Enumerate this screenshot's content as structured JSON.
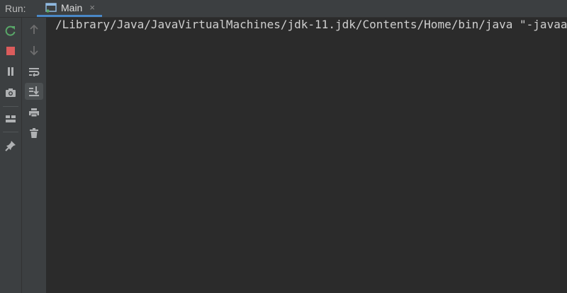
{
  "header": {
    "run_label": "Run:",
    "tab": {
      "label": "Main",
      "close_glyph": "×"
    }
  },
  "toolbar_left": [
    {
      "name": "rerun-icon",
      "color": "#59a869"
    },
    {
      "name": "stop-icon",
      "color": "#db5c5c"
    },
    {
      "name": "pause-icon",
      "color": "#afb1b3"
    },
    {
      "name": "camera-icon",
      "color": "#afb1b3"
    },
    {
      "name": "layout-icon",
      "color": "#afb1b3"
    },
    {
      "name": "pin-icon",
      "color": "#afb1b3"
    }
  ],
  "toolbar_right": [
    {
      "name": "up-arrow-icon",
      "color": "#6e6e6e"
    },
    {
      "name": "down-arrow-icon",
      "color": "#6e6e6e"
    },
    {
      "name": "soft-wrap-icon",
      "color": "#afb1b3"
    },
    {
      "name": "scroll-to-end-icon",
      "color": "#afb1b3"
    },
    {
      "name": "print-icon",
      "color": "#afb1b3"
    },
    {
      "name": "trash-icon",
      "color": "#afb1b3"
    }
  ],
  "console": {
    "lines": [
      "/Library/Java/JavaVirtualMachines/jdk-11.jdk/Contents/Home/bin/java \"-javaagent:"
    ]
  },
  "colors": {
    "background": "#2b2b2b",
    "panel": "#3c3f41",
    "accent": "#4a88c7",
    "run_green": "#59a869",
    "stop_red": "#db5c5c"
  }
}
